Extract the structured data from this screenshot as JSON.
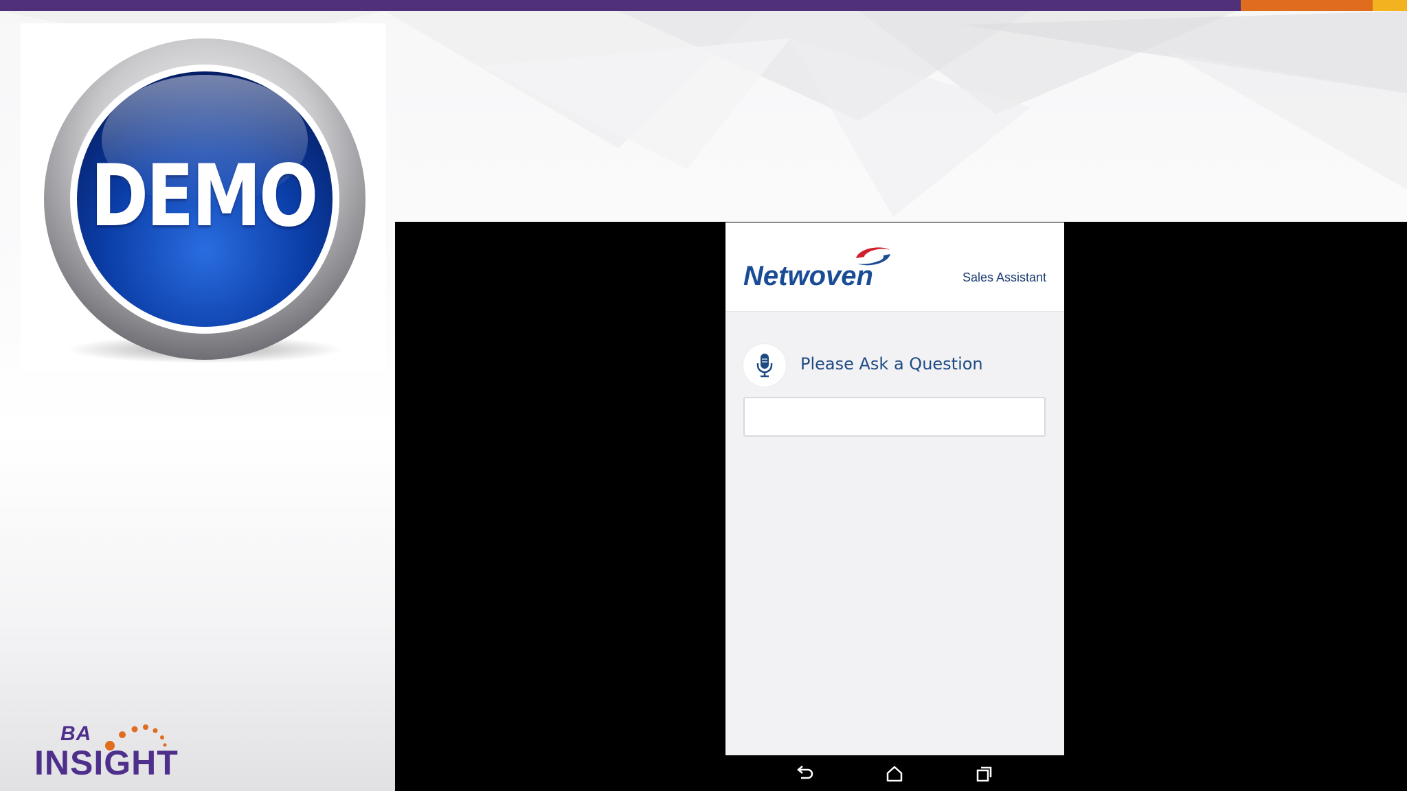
{
  "colors": {
    "stripe_purple": "#4f3079",
    "stripe_orange": "#e06c1e",
    "stripe_yellow": "#f3b320",
    "demo_blue": "#0b3ea8",
    "netwoven_blue": "#1a4c96",
    "netwoven_red": "#d0202e",
    "ba_purple": "#4e2f8b",
    "ba_orange": "#e06c1e"
  },
  "demo_badge": {
    "label": "DEMO",
    "icon": "demo-badge-icon"
  },
  "branding": {
    "ba_prefix": "BA",
    "ba_name": "INSIGHT"
  },
  "app": {
    "brand": "Netwoven",
    "subtitle": "Sales Assistant",
    "mic_icon": "microphone-icon",
    "prompt": "Please Ask a Question",
    "question_value": ""
  },
  "nav": {
    "back_icon": "back-icon",
    "home_icon": "home-icon",
    "recents_icon": "recent-apps-icon"
  }
}
